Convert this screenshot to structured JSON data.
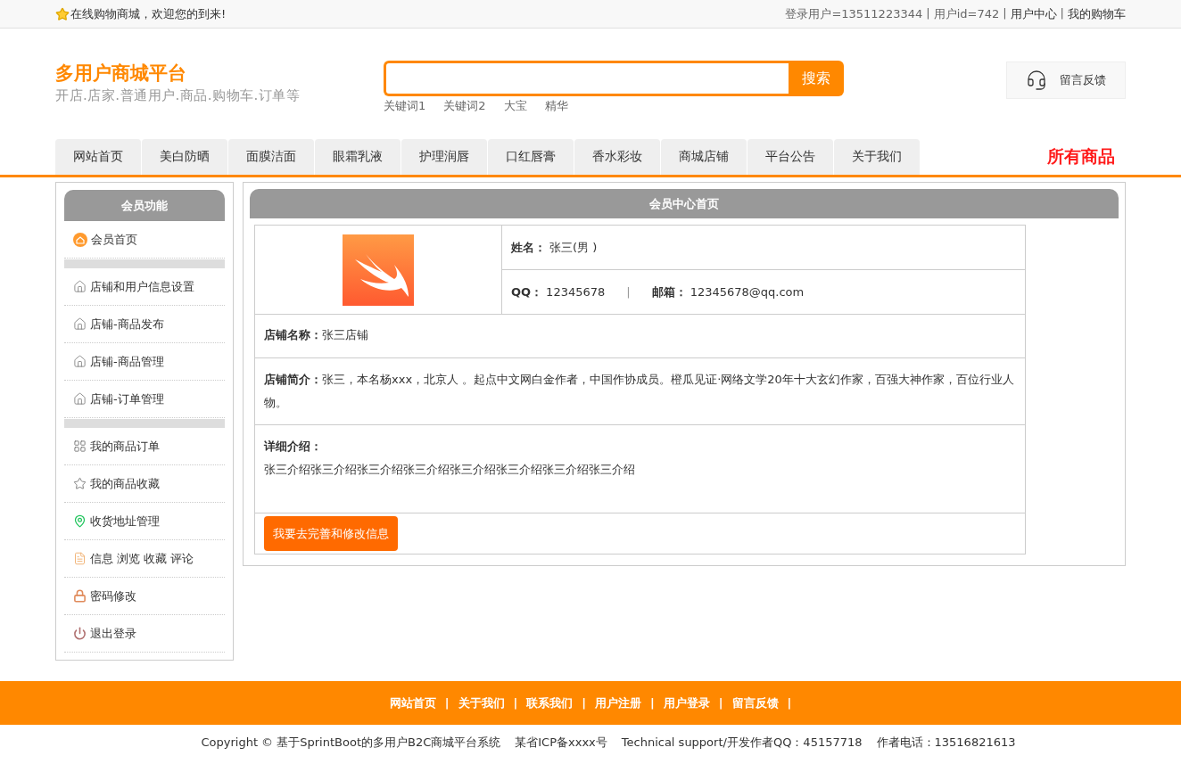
{
  "top_bar": {
    "welcome": "在线购物商城，欢迎您的到来!",
    "links": [
      {
        "label": "登录用户=13511223344",
        "kind": "text",
        "separator": "|"
      },
      {
        "label": "用户id=742",
        "kind": "text",
        "separator": "|"
      },
      {
        "label": "用户中心",
        "kind": "link",
        "separator": "|"
      },
      {
        "label": "我的购物车",
        "kind": "link"
      }
    ]
  },
  "header": {
    "title": "多用户商城平台",
    "subtitle": "开店.店家.普通用户.商品.购物车.订单等",
    "search_button": "搜索",
    "keywords": [
      "关键词1",
      "关键词2",
      "大宝",
      "精华"
    ],
    "feedback": "留言反馈"
  },
  "nav": {
    "tabs": [
      "网站首页",
      "美白防晒",
      "面膜洁面",
      "眼霜乳液",
      "护理润唇",
      "口红唇膏",
      "香水彩妆",
      "商城店铺",
      "平台公告",
      "关于我们"
    ],
    "all_products": "所有商品"
  },
  "sidebar": {
    "title": "会员功能",
    "groups": [
      [
        "会员首页"
      ],
      [
        "店铺和用户信息设置",
        "店铺-商品发布",
        "店铺-商品管理",
        "店铺-订单管理"
      ],
      [
        "我的商品订单",
        "我的商品收藏",
        "收货地址管理",
        "信息 浏览 收藏 评论",
        "密码修改",
        "退出登录"
      ]
    ]
  },
  "member_panel": {
    "title": "会员中心首页",
    "name": {
      "label": "姓名：",
      "value": "张三(男 )"
    },
    "qq": {
      "label": "QQ：",
      "value": "12345678"
    },
    "divider": "|",
    "email": {
      "label": "邮箱：",
      "value": "12345678@qq.com"
    },
    "shop_name": {
      "label": "店铺名称：",
      "value": "张三店铺"
    },
    "shop_intro": {
      "label": "店铺简介：",
      "value": "张三，本名杨xxx，北京人 。起点中文网白金作者，中国作协成员。橙瓜见证·网络文学20年十大玄幻作家，百强大神作家，百位行业人物。"
    },
    "details": {
      "label": "详细介绍：",
      "value": "张三介绍张三介绍张三介绍张三介绍张三介绍张三介绍张三介绍张三介绍"
    },
    "edit_button": "我要去完善和修改信息"
  },
  "footer": {
    "links": [
      {
        "label": "网站首页",
        "separator": "|"
      },
      {
        "label": "关于我们",
        "separator": "|"
      },
      {
        "label": "联系我们",
        "separator": "|"
      },
      {
        "label": "用户注册",
        "separator": "|"
      },
      {
        "label": "用户登录",
        "separator": "|"
      },
      {
        "label": "留言反馈",
        "separator": "|"
      }
    ],
    "copyright": [
      "Copyright © 基于SprintBoot的多用户B2C商城平台系统",
      "某省ICP备xxxx号",
      "Technical support/开发作者QQ：45157718",
      "作者电话：13516821613"
    ]
  }
}
